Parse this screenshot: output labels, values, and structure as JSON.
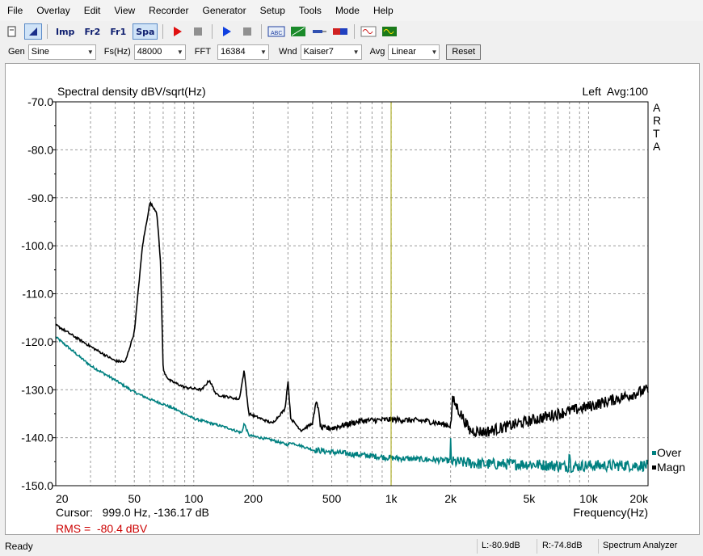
{
  "menu": [
    "File",
    "Overlay",
    "Edit",
    "View",
    "Recorder",
    "Generator",
    "Setup",
    "Tools",
    "Mode",
    "Help"
  ],
  "toolbar": [
    {
      "name": "new-doc-icon",
      "label": "",
      "kind": "icon"
    },
    {
      "name": "analyze-icon",
      "label": "",
      "kind": "icon",
      "active": true
    },
    {
      "name": "imp-mode-button",
      "label": "Imp",
      "kind": "text"
    },
    {
      "name": "fr2-mode-button",
      "label": "Fr2",
      "kind": "text"
    },
    {
      "name": "fr1-mode-button",
      "label": "Fr1",
      "kind": "text"
    },
    {
      "name": "spa-mode-button",
      "label": "Spa",
      "kind": "text",
      "active": true
    },
    {
      "name": "record-icon",
      "label": "",
      "kind": "icon"
    },
    {
      "name": "stop-icon",
      "label": "",
      "kind": "icon"
    },
    {
      "name": "play-icon",
      "label": "",
      "kind": "icon"
    },
    {
      "name": "stop2-icon",
      "label": "",
      "kind": "icon"
    },
    {
      "name": "abc-icon",
      "label": "",
      "kind": "icon"
    },
    {
      "name": "scale-icon",
      "label": "",
      "kind": "icon"
    },
    {
      "name": "probe-icon",
      "label": "",
      "kind": "icon"
    },
    {
      "name": "meter-icon",
      "label": "",
      "kind": "icon"
    },
    {
      "name": "wave-icon",
      "label": "",
      "kind": "icon"
    },
    {
      "name": "scope-icon",
      "label": "",
      "kind": "icon"
    }
  ],
  "settings": {
    "gen_label": "Gen",
    "gen_value": "Sine",
    "fs_label": "Fs(Hz)",
    "fs_value": "48000",
    "fft_label": "FFT",
    "fft_value": "16384",
    "wnd_label": "Wnd",
    "wnd_value": "Kaiser7",
    "avg_label": "Avg",
    "avg_value": "Linear",
    "reset_label": "Reset"
  },
  "chart_data": {
    "type": "line",
    "title": "Spectral density dBV/sqrt(Hz)",
    "channel_info": "Left  Avg:100",
    "brand": [
      "A",
      "R",
      "T",
      "A"
    ],
    "xlabel": "Frequency(Hz)",
    "x_scale": "log",
    "xlim": [
      20,
      20000
    ],
    "ylim": [
      -150,
      -70
    ],
    "y_ticks": [
      -70,
      -80,
      -90,
      -100,
      -110,
      -120,
      -130,
      -140,
      -150
    ],
    "y_tick_labels": [
      "-70.0",
      "-80.0",
      "-90.0",
      "-100.0",
      "-110.0",
      "-120.0",
      "-130.0",
      "-140.0",
      "-150.0"
    ],
    "x_ticks": [
      20,
      50,
      100,
      200,
      500,
      1000,
      2000,
      5000,
      10000,
      20000
    ],
    "x_tick_labels": [
      "20",
      "50",
      "100",
      "200",
      "500",
      "1k",
      "2k",
      "5k",
      "10k",
      "20k"
    ],
    "grid": true,
    "cursor_freq": 999.0,
    "cursor_text": "Cursor:   999.0 Hz, -136.17 dB",
    "rms_text": "RMS =  -80.4 dBV",
    "legend": [
      {
        "label": "Over",
        "color": "#008080"
      },
      {
        "label": "Magn",
        "color": "#000000"
      }
    ],
    "colors": {
      "magn": "#000000",
      "over": "#008080",
      "cursor": "#a0a000",
      "rms": "#cc0000"
    },
    "series": [
      {
        "name": "Magn",
        "x": [
          20,
          30,
          40,
          45,
          50,
          55,
          60,
          65,
          68,
          70,
          75,
          90,
          110,
          120,
          130,
          170,
          180,
          190,
          250,
          290,
          300,
          310,
          350,
          400,
          420,
          440,
          500,
          700,
          1000,
          1500,
          2000,
          2050,
          2500,
          3000,
          4000,
          5000,
          7000,
          10000,
          15000,
          20000
        ],
        "y": [
          -116.5,
          -121,
          -124,
          -124.2,
          -118,
          -100,
          -91,
          -93,
          -104,
          -126,
          -128,
          -129.5,
          -130,
          -128,
          -131,
          -132,
          -126,
          -135,
          -137,
          -134,
          -128,
          -136,
          -138.5,
          -137,
          -132,
          -138,
          -138,
          -136.5,
          -136.2,
          -136.5,
          -137.5,
          -132,
          -138.5,
          -138.8,
          -137.5,
          -136.5,
          -135,
          -133.5,
          -131.5,
          -130
        ]
      },
      {
        "name": "Over",
        "x": [
          20,
          30,
          40,
          50,
          60,
          70,
          80,
          100,
          150,
          175,
          180,
          190,
          250,
          300,
          310,
          400,
          500,
          1000,
          1990,
          2000,
          2010,
          3000,
          5000,
          7900,
          8000,
          8100,
          10000,
          15000,
          20000
        ],
        "y": [
          -119,
          -125,
          -128,
          -130.5,
          -132,
          -133,
          -134,
          -136,
          -138,
          -139,
          -137,
          -139.5,
          -140.5,
          -141.5,
          -141,
          -142.5,
          -143,
          -144.2,
          -144.8,
          -141,
          -145,
          -145.5,
          -145.5,
          -146,
          -142,
          -146,
          -145.8,
          -145.8,
          -145.8
        ]
      }
    ]
  },
  "status": {
    "ready": "Ready",
    "left_level": "L:-80.9dB",
    "right_level": "R:-74.8dB",
    "mode": "Spectrum Analyzer"
  }
}
